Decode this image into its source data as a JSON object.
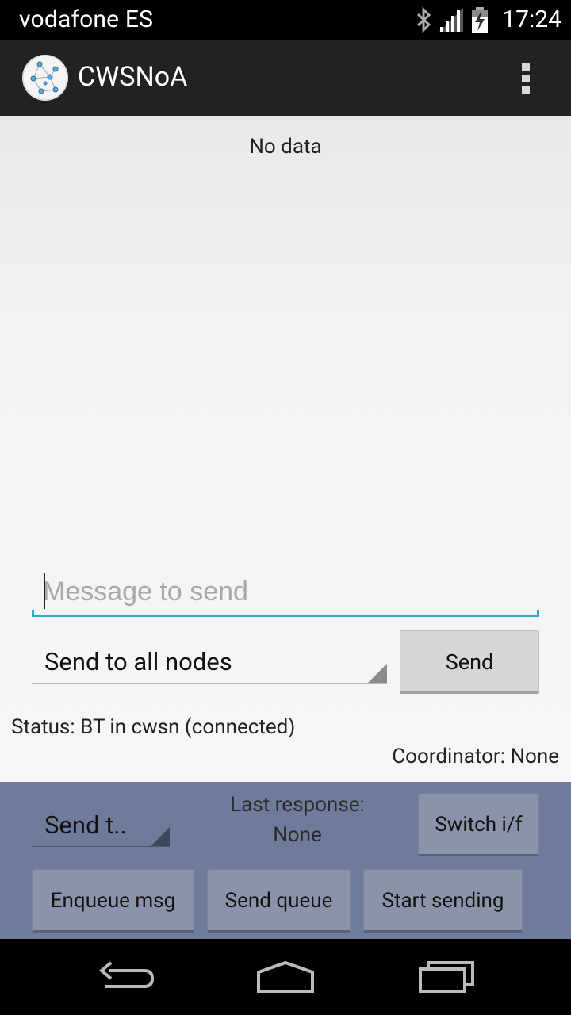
{
  "status_bar": {
    "carrier": "vodafone ES",
    "time": "17:24",
    "icons": [
      "bluetooth-icon",
      "signal-icon",
      "battery-charging-icon"
    ]
  },
  "action_bar": {
    "title": "CWSNoA",
    "logo_icon": "network-nodes-logo-icon",
    "overflow_icon": "overflow-menu-icon"
  },
  "main": {
    "no_data": "No data",
    "message_input": {
      "value": "",
      "placeholder": "Message to send"
    },
    "destination_spinner": {
      "selected": "Send to all nodes"
    },
    "send_button": "Send",
    "status": "Status: BT in cwsn (connected)",
    "coordinator": "Coordinator: None"
  },
  "panel": {
    "mode_spinner": {
      "selected": "Send t.."
    },
    "last_response_label": "Last response:",
    "last_response_value": "None",
    "switch_button": "Switch i/f",
    "enqueue_button": "Enqueue msg",
    "send_queue_button": "Send queue",
    "start_sending_button": "Start sending"
  },
  "nav_bar": {
    "icons": [
      "back-icon",
      "home-icon",
      "recents-icon"
    ]
  },
  "colors": {
    "accent": "#2fa8c9",
    "panel_bg": "#6f7b9a",
    "action_bar_bg": "#222222"
  }
}
